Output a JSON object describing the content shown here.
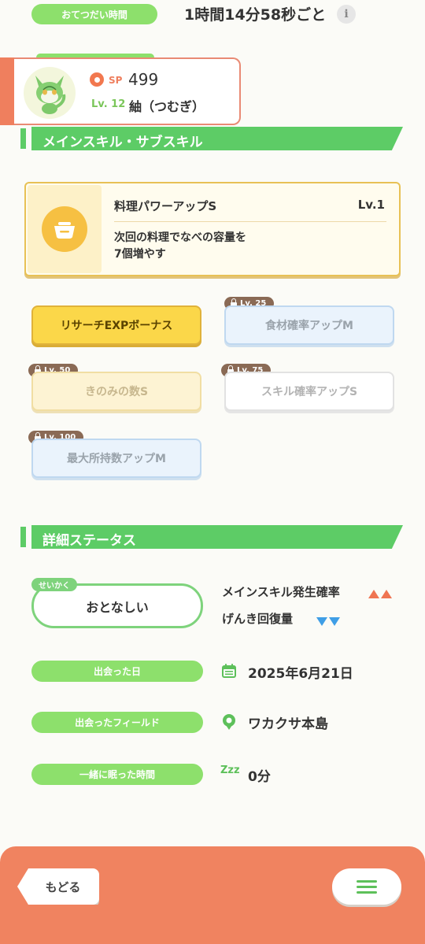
{
  "help": {
    "label": "おてつだい時間",
    "value": "1時間14分58秒ごと",
    "info_icon": "i"
  },
  "pokemon": {
    "sp_label": "SP",
    "sp_value": "499",
    "level": "Lv. 12",
    "name": "紬（つむぎ）"
  },
  "skills_section": {
    "title": "メインスキル・サブスキル"
  },
  "main_skill": {
    "name": "料理パワーアップS",
    "level": "Lv.1",
    "desc_line1": "次回の料理でなべの容量を",
    "desc_line2": "7個増やす"
  },
  "sub_skills": [
    {
      "label": "リサーチEXPボーナス",
      "lock": ""
    },
    {
      "label": "食材確率アップM",
      "lock": "Lv. 25"
    },
    {
      "label": "きのみの数S",
      "lock": "Lv. 50"
    },
    {
      "label": "スキル確率アップS",
      "lock": "Lv. 75"
    },
    {
      "label": "最大所持数アップM",
      "lock": "Lv. 100"
    }
  ],
  "details_section": {
    "title": "詳細ステータス"
  },
  "nature": {
    "tag": "せいかく",
    "name": "おとなしい",
    "up_label": "メインスキル発生確率",
    "down_label": "げんき回復量"
  },
  "met_date": {
    "label": "出会った日",
    "value": "2025年6月21日"
  },
  "met_field": {
    "label": "出会ったフィールド",
    "value": "ワカクサ本島"
  },
  "sleep_time": {
    "label": "一緒に眠った時間",
    "value": "0分",
    "icon": "Zzz"
  },
  "footer": {
    "back_label": "もどる"
  },
  "colors": {
    "green": "#5dcc66",
    "accent": "#f08360",
    "skill_yellow": "#fbd749",
    "up": "#ef7452",
    "down": "#3f9ee6"
  }
}
